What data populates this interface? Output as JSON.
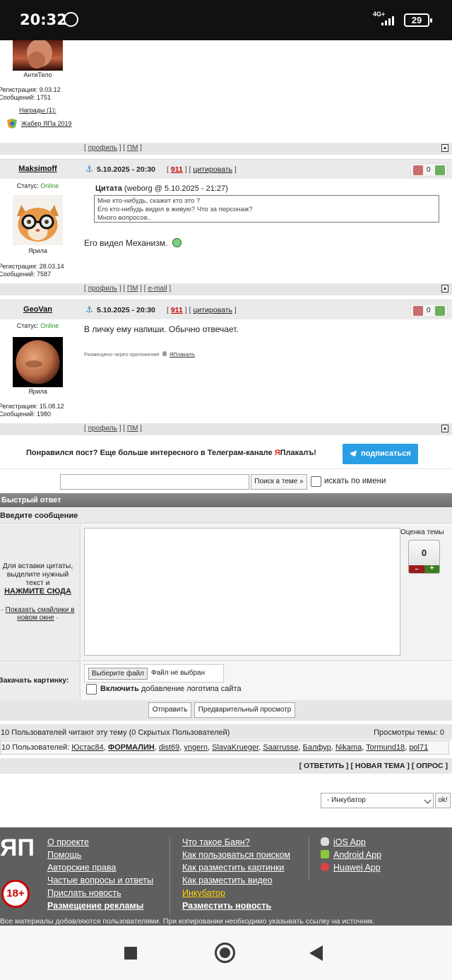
{
  "status_bar": {
    "time": "20:32",
    "network": "4G+",
    "battery": "29"
  },
  "post0": {
    "rank": "АнтиТело",
    "reg": "Регистрация: 9.03.12",
    "msgs": "Сообщений: 1751",
    "awards": "Награды (1):",
    "award_name": "Жабер ЯПа 2019",
    "foot": {
      "profile": "профиль",
      "pm": "ПМ"
    }
  },
  "post1": {
    "nick": "Maksimoff",
    "date": "5.10.2025 - 20:30",
    "num": "911",
    "quote_action": "цитировать",
    "rating": "0",
    "status_label": "Статус:",
    "status": "Online",
    "rank": "Ярила",
    "reg": "Регистрация: 28.03.14",
    "msgs": "Сообщений: 7587",
    "quote_title": "Цитата",
    "quote_meta": "(weborg @ 5.10.2025 - 21:27)",
    "quote_lines": [
      "Мне кто-нибудь, скажет кто это ?",
      "Его кто-нибудь видел в живую? Что за персонаж?",
      "Много вопросов.."
    ],
    "text": "Его видел Механизм.",
    "foot": {
      "profile": "профиль",
      "pm": "ПМ",
      "email": "e-mail"
    }
  },
  "post2": {
    "nick": "GeoVan",
    "date": "5.10.2025 - 20:30",
    "num": "911",
    "quote_action": "цитировать",
    "rating": "0",
    "status_label": "Статус:",
    "status": "Online",
    "rank": "Ярила",
    "reg": "Регистрация: 15.08.12",
    "msgs": "Сообщений: 1980",
    "text": "В личку ему напиши. Обычно отвечает.",
    "app_note": "Размещено через приложение",
    "app_name": "ЯПлакалъ",
    "foot": {
      "profile": "профиль",
      "pm": "ПМ"
    }
  },
  "telegram": {
    "text_before": "Понравился пост? Еще больше интересного в Телеграм-канале ",
    "brand_red": "Я",
    "brand_rest": "Плакалъ!",
    "button": "подписаться"
  },
  "search": {
    "button": "Поиск в теме »",
    "by_name": "искать по имени"
  },
  "quick_reply": {
    "title": "Быстрый ответ",
    "subtitle": "Введите сообщение",
    "hint": "Для вставки цитаты, выделите нужный текст и",
    "hint_link": "НАЖМИТЕ СЮДА",
    "smiles_link": "Показать смайлики в новом окне",
    "rating_label": "Оценка темы",
    "rating_value": "0",
    "upload_label": "Закачать картинку:",
    "file_button": "Выберите файл",
    "file_status": "Файл не выбран",
    "logo_bold": "Включить",
    "logo_rest": "добавление логотипа сайта",
    "send": "Отправить",
    "preview": "Предварительный просмотр"
  },
  "readers": {
    "summary": "10 Пользователей читают эту тему (0 Скрытых Пользователей)",
    "views": "Просмотры темы: 0",
    "prefix": "10 Пользователей:",
    "users": [
      "Юстас84",
      "ФОРМАЛИН",
      "dist69",
      "yngern",
      "SlavaKrueger",
      "Saarrusse",
      "Балфур",
      "Nikama",
      "Tormund18",
      "pol71"
    ]
  },
  "actions": {
    "reply": "ОТВЕТИТЬ",
    "new_topic": "НОВАЯ ТЕМА",
    "poll": "ОПРОС"
  },
  "jump": {
    "selected": "- Инкубатор",
    "go": "ok!"
  },
  "footer": {
    "logo": "ЯП",
    "age": "18+",
    "col1": [
      "О проекте",
      "Помощь",
      "Авторские права",
      "Частые вопросы и ответы",
      "Прислать новость",
      "Размещение рекламы"
    ],
    "col2": [
      "Что такое Баян?",
      "Как пользоваться поиском",
      "Как разместить картинки",
      "Как разместить видео",
      "Инкубатор",
      "Разместить новость"
    ],
    "col3": [
      "iOS App",
      "Android App",
      "Huawei App"
    ],
    "copyright": "Все материалы добавляются пользователями. При копировании необходимо указывать ссылку на источник."
  },
  "colors": {
    "accent": "#2a9ee4",
    "online": "#2a9a2a",
    "footer_bg": "#5f5f5f",
    "highlight": "#ffd200"
  }
}
